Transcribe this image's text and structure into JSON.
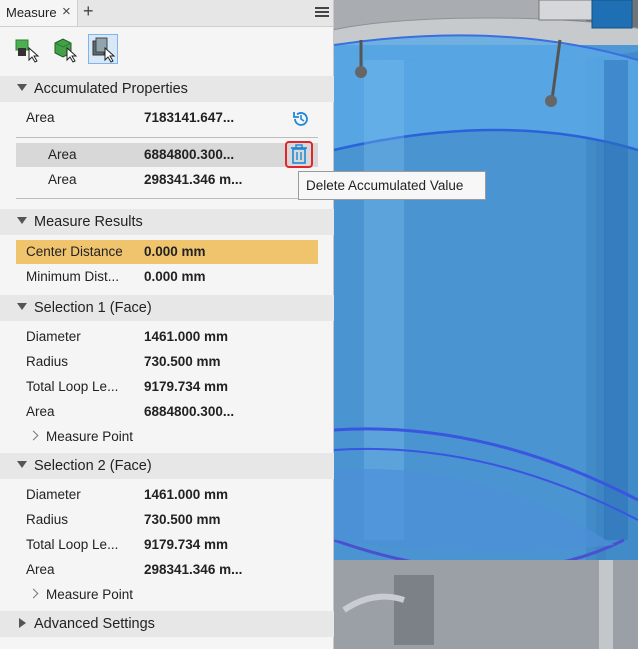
{
  "tab": {
    "label": "Measure",
    "close": "×",
    "add": "+"
  },
  "accumulated": {
    "title": "Accumulated Properties",
    "total": {
      "key": "Area",
      "value": "7183141.647..."
    },
    "items": [
      {
        "key": "Area",
        "value": "6884800.300..."
      },
      {
        "key": "Area",
        "value": "298341.346 m..."
      }
    ]
  },
  "tooltip": "Delete Accumulated Value",
  "results": {
    "title": "Measure Results",
    "rows": [
      {
        "key": "Center Distance",
        "value": "0.000 mm"
      },
      {
        "key": "Minimum Dist...",
        "value": "0.000 mm"
      }
    ]
  },
  "selection1": {
    "title": "Selection 1 (Face)",
    "rows": [
      {
        "key": "Diameter",
        "value": "1461.000 mm"
      },
      {
        "key": "Radius",
        "value": "730.500 mm"
      },
      {
        "key": "Total Loop Le...",
        "value": "9179.734 mm"
      },
      {
        "key": "Area",
        "value": "6884800.300..."
      }
    ],
    "measure_point": "Measure Point"
  },
  "selection2": {
    "title": "Selection 2 (Face)",
    "rows": [
      {
        "key": "Diameter",
        "value": "1461.000 mm"
      },
      {
        "key": "Radius",
        "value": "730.500 mm"
      },
      {
        "key": "Total Loop Le...",
        "value": "9179.734 mm"
      },
      {
        "key": "Area",
        "value": "298341.346 m..."
      }
    ],
    "measure_point": "Measure Point"
  },
  "advanced": {
    "title": "Advanced Settings"
  },
  "icons": [
    "select-other-icon",
    "select-face-icon",
    "select-body-icon",
    "history-icon",
    "trash-icon",
    "menu-icon"
  ],
  "colors": {
    "highlight_row": "#f0c36d",
    "delete_outline": "#e0252b",
    "accent": "#1e88d8"
  }
}
